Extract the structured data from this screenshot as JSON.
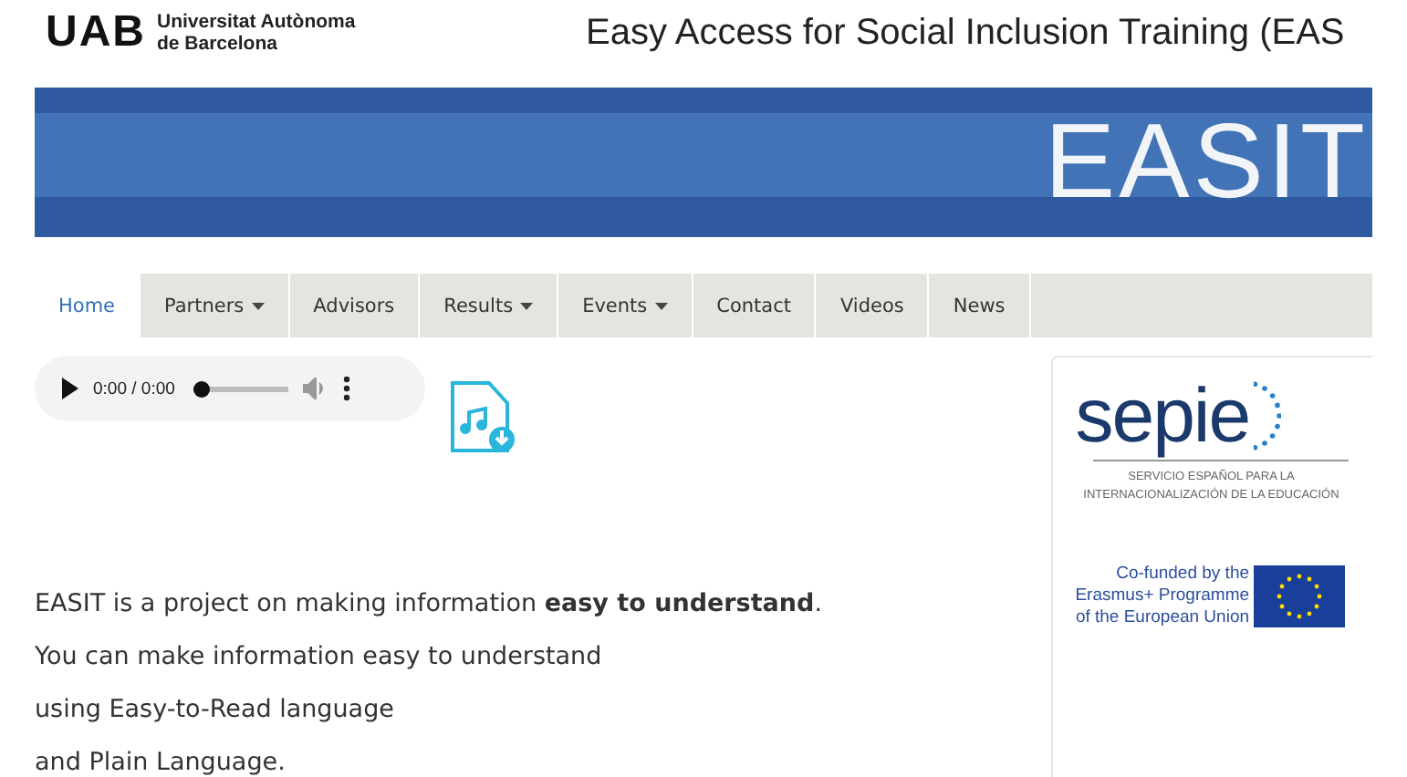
{
  "header": {
    "logo_mark": "UAB",
    "logo_text": [
      "Universitat Autònoma",
      "de Barcelona"
    ],
    "title": "Easy Access for Social Inclusion Training (EAS"
  },
  "banner": {
    "logo": "EASIT"
  },
  "nav": [
    {
      "label": "Home",
      "selected": true,
      "dropdown": false
    },
    {
      "label": "Partners",
      "selected": false,
      "dropdown": true
    },
    {
      "label": "Advisors",
      "selected": false,
      "dropdown": false
    },
    {
      "label": "Results",
      "selected": false,
      "dropdown": true
    },
    {
      "label": "Events",
      "selected": false,
      "dropdown": true
    },
    {
      "label": "Contact",
      "selected": false,
      "dropdown": false
    },
    {
      "label": "Videos",
      "selected": false,
      "dropdown": false
    },
    {
      "label": "News",
      "selected": false,
      "dropdown": false
    }
  ],
  "audio": {
    "time": "0:00 / 0:00",
    "level": 0
  },
  "intro": [
    "EASIT is a project on making information **easy to understand**.",
    "You can make information easy to understand",
    "using Easy-to-Read language",
    "and Plain Language."
  ],
  "sidebar": {
    "sepie": {
      "logo": "sepie",
      "caption": [
        "SERVICIO ESPAÑOL PARA LA",
        "INTERNACIONALIZACIÓN DE LA EDUCACIÓN"
      ]
    },
    "erasmus": {
      "text": [
        "Co-funded by the",
        "Erasmus+ Programme",
        "of the European Union"
      ]
    }
  }
}
